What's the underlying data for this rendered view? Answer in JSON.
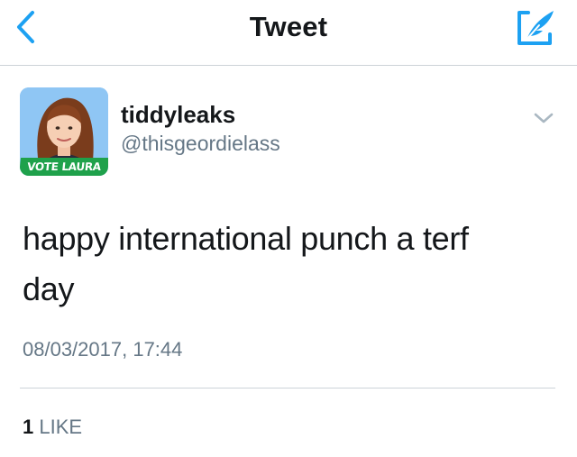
{
  "nav": {
    "title": "Tweet",
    "back_icon": "chevron-left-icon",
    "compose_icon": "compose-feather-icon",
    "accent_color": "#1da1f2"
  },
  "tweet": {
    "author": {
      "display_name": "tiddyleaks",
      "handle": "@thisgeordielass",
      "avatar_badge_text": "VOTE LAURA",
      "badge_color": "#1fa14b"
    },
    "text": "happy international punch a terf day",
    "timestamp": "08/03/2017, 17:44",
    "likes": {
      "count": "1",
      "label": "LIKE"
    },
    "menu_icon": "chevron-down-icon"
  }
}
